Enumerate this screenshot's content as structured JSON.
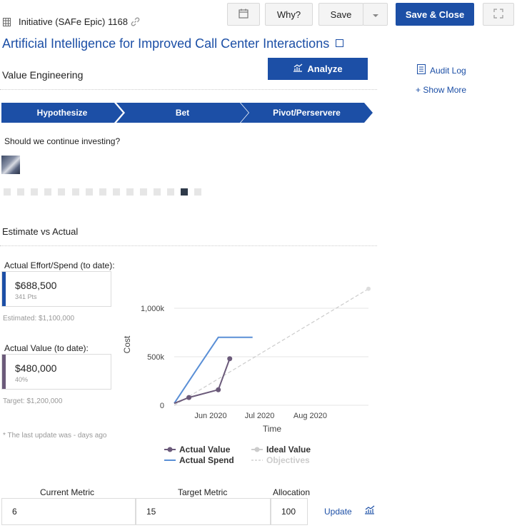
{
  "header": {
    "item_type": "Initiative (SAFe Epic) 1168",
    "why_label": "Why?",
    "save_label": "Save",
    "save_close_label": "Save & Close"
  },
  "title": "Artificial Intelligence for Improved Call Center Interactions",
  "section_value": "Value Engineering",
  "analyze_label": "Analyze",
  "side": {
    "audit_log": "Audit Log",
    "show_more": "+ Show More"
  },
  "stages": [
    "Hypothesize",
    "Bet",
    "Pivot/Perservere"
  ],
  "question": "Should we continue investing?",
  "progress": {
    "total": 15,
    "active_index": 13
  },
  "section_estimate": "Estimate vs Actual",
  "effort": {
    "label": "Actual Effort/Spend (to date):",
    "value": "$688,500",
    "sub": "341 Pts",
    "estimated": "Estimated: $1,100,000",
    "color": "#1c4fa6"
  },
  "value_card": {
    "label": "Actual Value (to date):",
    "value": "$480,000",
    "sub": "40%",
    "target": "Target: $1,200,000",
    "color": "#6b5a7a"
  },
  "last_update": "* The last update was - days ago",
  "chart_data": {
    "type": "line",
    "ylabel": "Cost",
    "xlabel": "Time",
    "y_ticks": [
      "0",
      "500k",
      "1,000k"
    ],
    "x_ticks": [
      "Jun 2020",
      "Jul 2020",
      "Aug 2020"
    ],
    "ylim": [
      0,
      1250000
    ],
    "x_range": [
      "2020-05-11",
      "2020-09-07"
    ],
    "series": [
      {
        "name": "Actual Value",
        "color": "#6b5a7a",
        "points": [
          [
            "2020-05-11",
            20000
          ],
          [
            "2020-05-20",
            80000
          ],
          [
            "2020-06-07",
            160000
          ],
          [
            "2020-06-14",
            480000
          ]
        ]
      },
      {
        "name": "Actual Spend",
        "color": "#5a8fd6",
        "points": [
          [
            "2020-05-11",
            20000
          ],
          [
            "2020-05-24",
            350000
          ],
          [
            "2020-06-07",
            700000
          ],
          [
            "2020-06-28",
            700000
          ]
        ]
      },
      {
        "name": "Ideal Value",
        "color": "#cccccc",
        "points": [
          [
            "2020-05-11",
            0
          ],
          [
            "2020-09-07",
            1200000
          ]
        ]
      },
      {
        "name": "Objectives",
        "color": "#dddddd",
        "points": []
      }
    ]
  },
  "metrics": {
    "current_label": "Current Metric",
    "target_label": "Target Metric",
    "allocation_label": "Allocation",
    "current_value": "6",
    "target_value": "15",
    "allocation_value": "100",
    "update_label": "Update"
  }
}
